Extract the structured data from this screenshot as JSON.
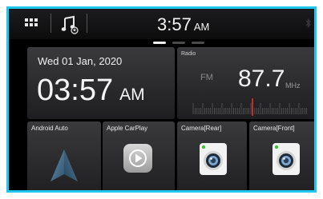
{
  "status_bar": {
    "time": "3:57",
    "ampm": "AM",
    "icons": [
      "apps-grid-icon",
      "music-source-icon",
      "bluetooth-icon"
    ]
  },
  "pager": {
    "pages": 3,
    "active": 0
  },
  "clock_widget": {
    "date": "Wed 01 Jan, 2020",
    "time": "03:57",
    "ampm": "AM"
  },
  "radio_widget": {
    "title": "Radio",
    "band": "FM",
    "frequency": "87.7",
    "unit": "MHz"
  },
  "apps": [
    {
      "label": "Android Auto",
      "icon": "android-auto-icon"
    },
    {
      "label": "Apple CarPlay",
      "icon": "carplay-icon"
    },
    {
      "label": "Camera[Rear]",
      "icon": "camera-icon"
    },
    {
      "label": "Camera[Front]",
      "icon": "camera-icon"
    }
  ],
  "colors": {
    "border_accent": "#1fc7ee",
    "background": "#000000",
    "tile": "#2c2c2e",
    "tuner_needle": "#e0322c",
    "camera_status_led": "#3fbf3f"
  }
}
